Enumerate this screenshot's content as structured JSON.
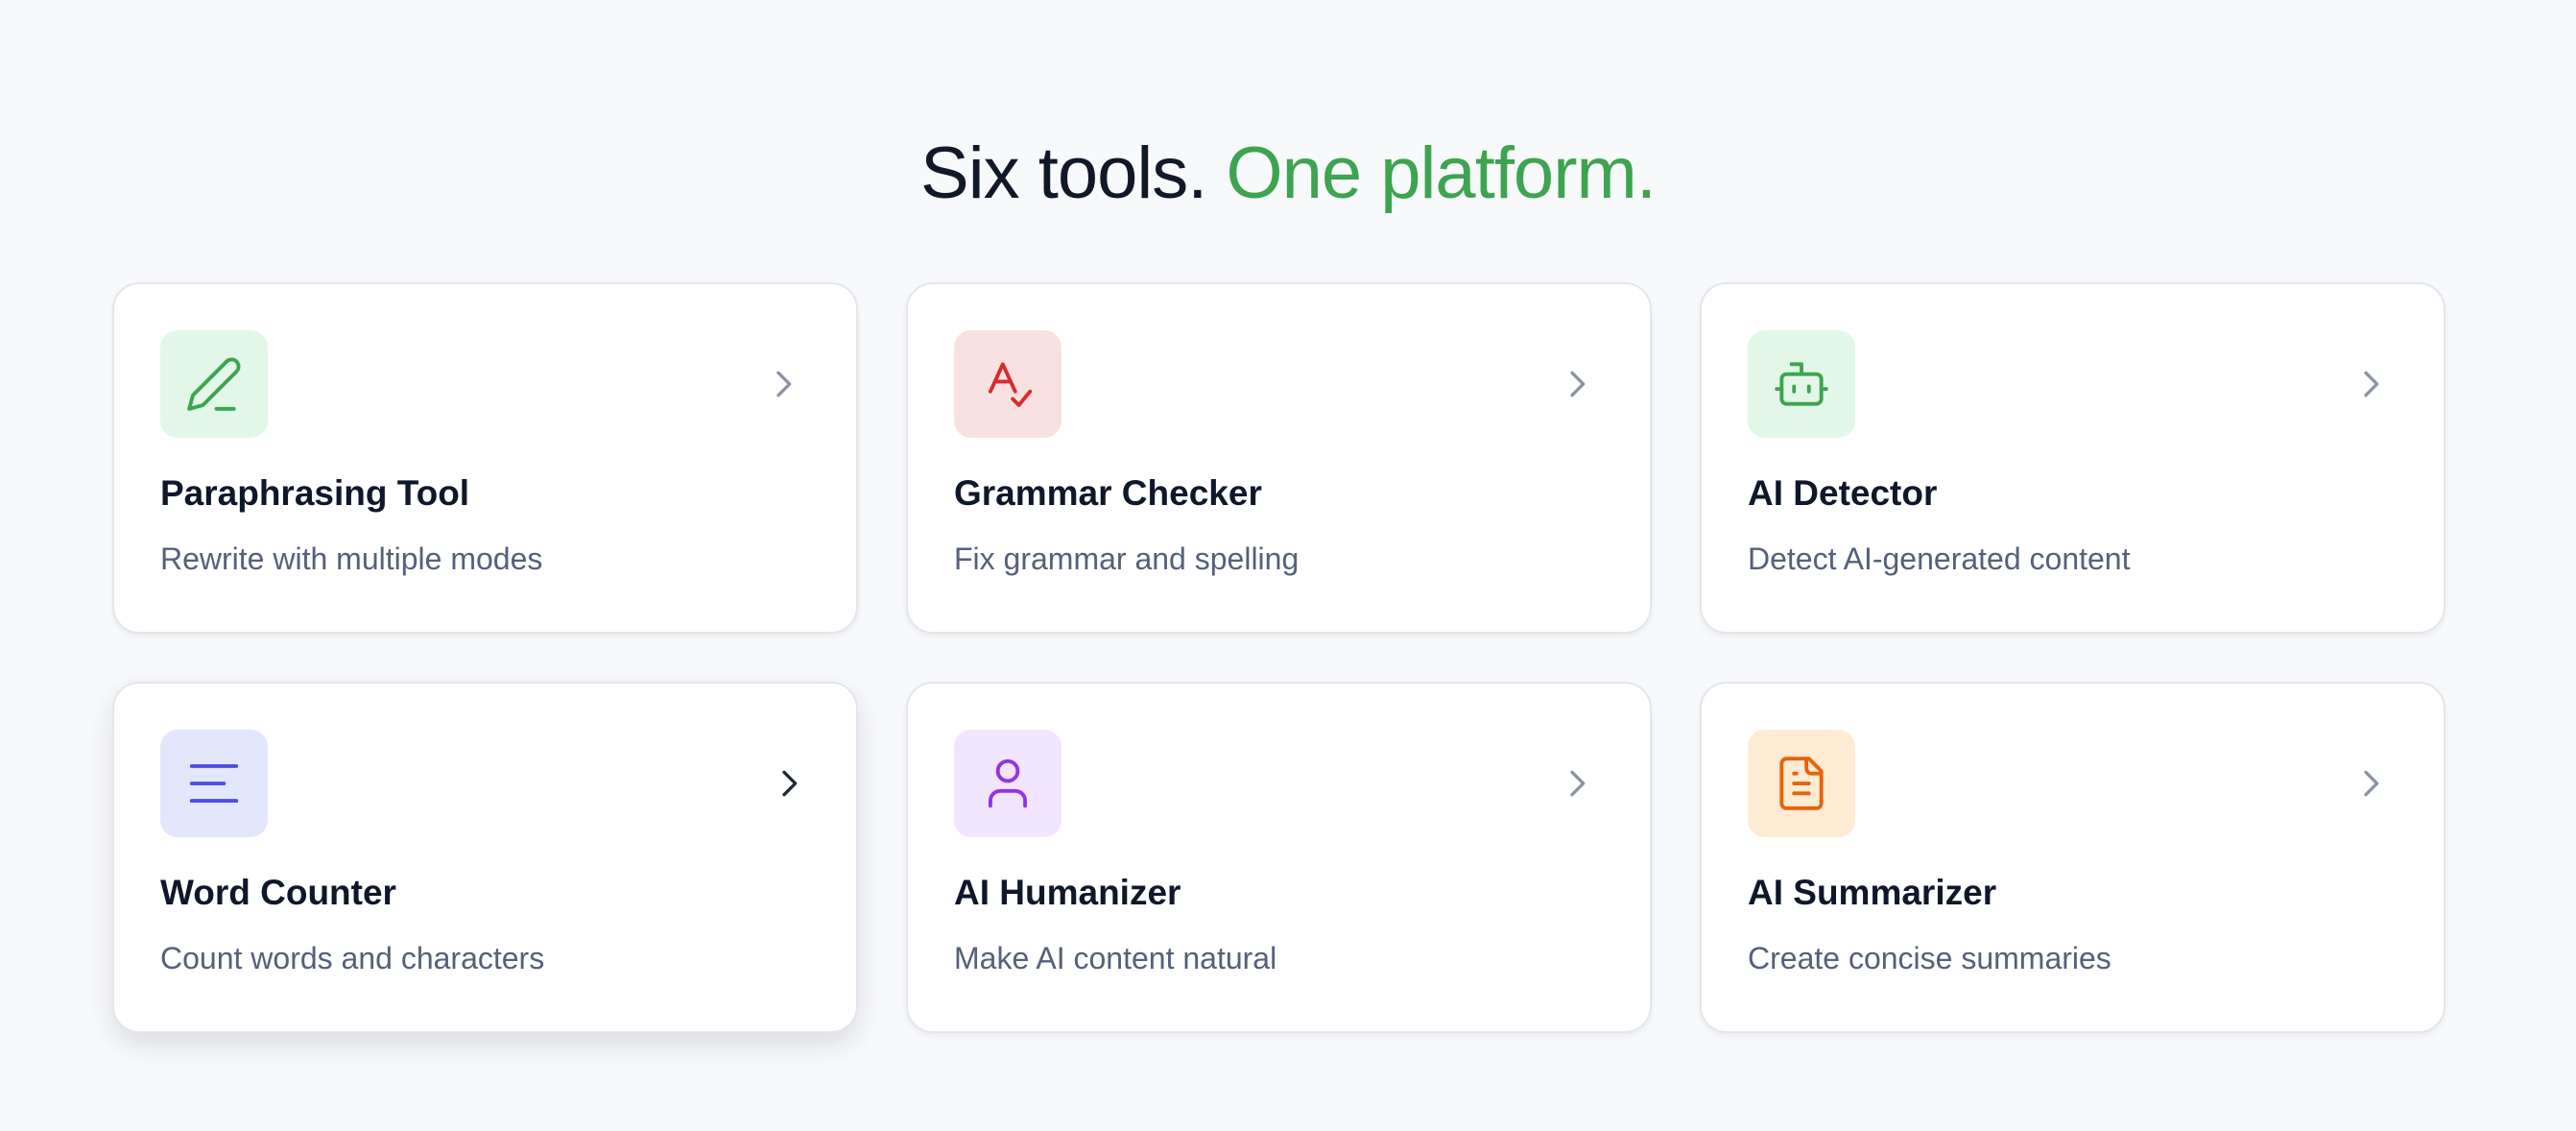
{
  "header": {
    "title_part1": "Six tools.",
    "title_part2": "One platform.",
    "accent_color": "#3da44f"
  },
  "tools": [
    {
      "title": "Paraphrasing Tool",
      "description": "Rewrite with multiple modes",
      "icon": "pen-icon",
      "icon_color": "#3da44f",
      "icon_bg": "#e2f7e7"
    },
    {
      "title": "Grammar Checker",
      "description": "Fix grammar and spelling",
      "icon": "spell-check-icon",
      "icon_color": "#d92b2b",
      "icon_bg": "#f9e1e1"
    },
    {
      "title": "AI Detector",
      "description": "Detect AI-generated content",
      "icon": "bot-icon",
      "icon_color": "#3da44f",
      "icon_bg": "#e2f7e7"
    },
    {
      "title": "Word Counter",
      "description": "Count words and characters",
      "icon": "text-lines-icon",
      "icon_color": "#4f4ee0",
      "icon_bg": "#e3e7fd"
    },
    {
      "title": "AI Humanizer",
      "description": "Make AI content natural",
      "icon": "user-icon",
      "icon_color": "#9333ea",
      "icon_bg": "#f1e6fd"
    },
    {
      "title": "AI Summarizer",
      "description": "Create concise summaries",
      "icon": "document-icon",
      "icon_color": "#e8630a",
      "icon_bg": "#fdebd3"
    }
  ]
}
